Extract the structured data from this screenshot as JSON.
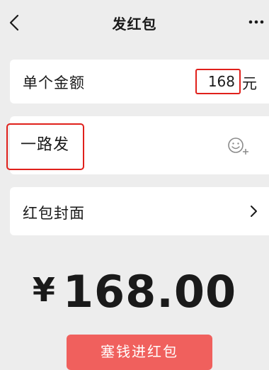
{
  "header": {
    "title": "发红包",
    "back_icon": "chevron-left-icon",
    "more_icon": "more-dots-icon"
  },
  "amount_row": {
    "label": "单个金额",
    "value": "168",
    "unit": "元"
  },
  "greeting_row": {
    "value": "一路发",
    "emoji_icon": "emoji-add-icon"
  },
  "cover_row": {
    "label": "红包封面",
    "chevron_icon": "chevron-right-icon"
  },
  "total": {
    "currency": "¥",
    "amount": "168.00"
  },
  "submit": {
    "label": "塞钱进红包"
  },
  "colors": {
    "background": "#ededed",
    "highlight": "#e0201b",
    "button": "#f0605d"
  }
}
